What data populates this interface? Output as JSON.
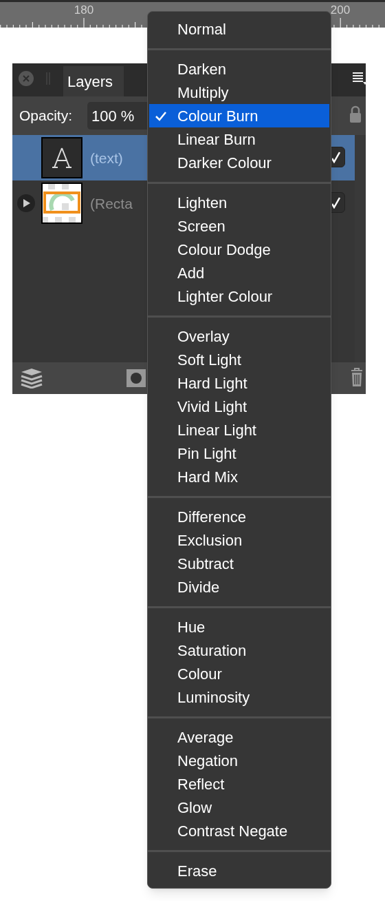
{
  "ruler": {
    "labels": [
      "180",
      "200"
    ]
  },
  "panel": {
    "tab": {
      "label": "Layers",
      "selected": true
    },
    "opacity": {
      "label": "Opacity:",
      "value": "100 %"
    },
    "layers": [
      {
        "kind": "text",
        "name": "(text)",
        "selected": true,
        "visible": true,
        "expandable": false
      },
      {
        "kind": "shape",
        "name": "(Recta",
        "selected": false,
        "visible": true,
        "expandable": true
      }
    ]
  },
  "blend_menu": {
    "groups": [
      [
        {
          "label": "Normal",
          "selected": false
        }
      ],
      [
        {
          "label": "Darken",
          "selected": false
        },
        {
          "label": "Multiply",
          "selected": false
        },
        {
          "label": "Colour Burn",
          "selected": true
        },
        {
          "label": "Linear Burn",
          "selected": false
        },
        {
          "label": "Darker Colour",
          "selected": false
        }
      ],
      [
        {
          "label": "Lighten",
          "selected": false
        },
        {
          "label": "Screen",
          "selected": false
        },
        {
          "label": "Colour Dodge",
          "selected": false
        },
        {
          "label": "Add",
          "selected": false
        },
        {
          "label": "Lighter Colour",
          "selected": false
        }
      ],
      [
        {
          "label": "Overlay",
          "selected": false
        },
        {
          "label": "Soft Light",
          "selected": false
        },
        {
          "label": "Hard Light",
          "selected": false
        },
        {
          "label": "Vivid Light",
          "selected": false
        },
        {
          "label": "Linear Light",
          "selected": false
        },
        {
          "label": "Pin Light",
          "selected": false
        },
        {
          "label": "Hard Mix",
          "selected": false
        }
      ],
      [
        {
          "label": "Difference",
          "selected": false
        },
        {
          "label": "Exclusion",
          "selected": false
        },
        {
          "label": "Subtract",
          "selected": false
        },
        {
          "label": "Divide",
          "selected": false
        }
      ],
      [
        {
          "label": "Hue",
          "selected": false
        },
        {
          "label": "Saturation",
          "selected": false
        },
        {
          "label": "Colour",
          "selected": false
        },
        {
          "label": "Luminosity",
          "selected": false
        }
      ],
      [
        {
          "label": "Average",
          "selected": false
        },
        {
          "label": "Negation",
          "selected": false
        },
        {
          "label": "Reflect",
          "selected": false
        },
        {
          "label": "Glow",
          "selected": false
        },
        {
          "label": "Contrast Negate",
          "selected": false
        }
      ],
      [
        {
          "label": "Erase",
          "selected": false
        }
      ]
    ]
  }
}
